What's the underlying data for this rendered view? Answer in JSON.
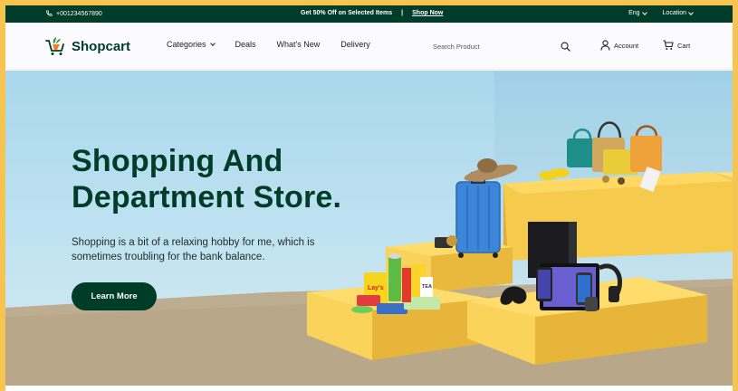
{
  "topbar": {
    "phone": "+001234567890",
    "promo_text": "Get 50% Off on Selected Items",
    "promo_separator": "|",
    "promo_link": "Shop Now",
    "language": "Eng",
    "location": "Location"
  },
  "nav": {
    "logo": "Shopcart",
    "menu": [
      "Categories",
      "Deals",
      "What's New",
      "Delivery"
    ],
    "search_placeholder": "Search Product",
    "account": "Account",
    "cart": "Cart"
  },
  "hero": {
    "title_line1": "Shopping And",
    "title_line2": "Department Store.",
    "subtitle": "Shopping is a bit of a relaxing hobby for me, which is sometimes troubling for the bank balance.",
    "cta": "Learn More"
  },
  "colors": {
    "brand_green": "#003d29",
    "border_yellow": "#f5c451",
    "platform_yellow": "#f3c84b",
    "sky_blue": "#a9d7ec"
  }
}
